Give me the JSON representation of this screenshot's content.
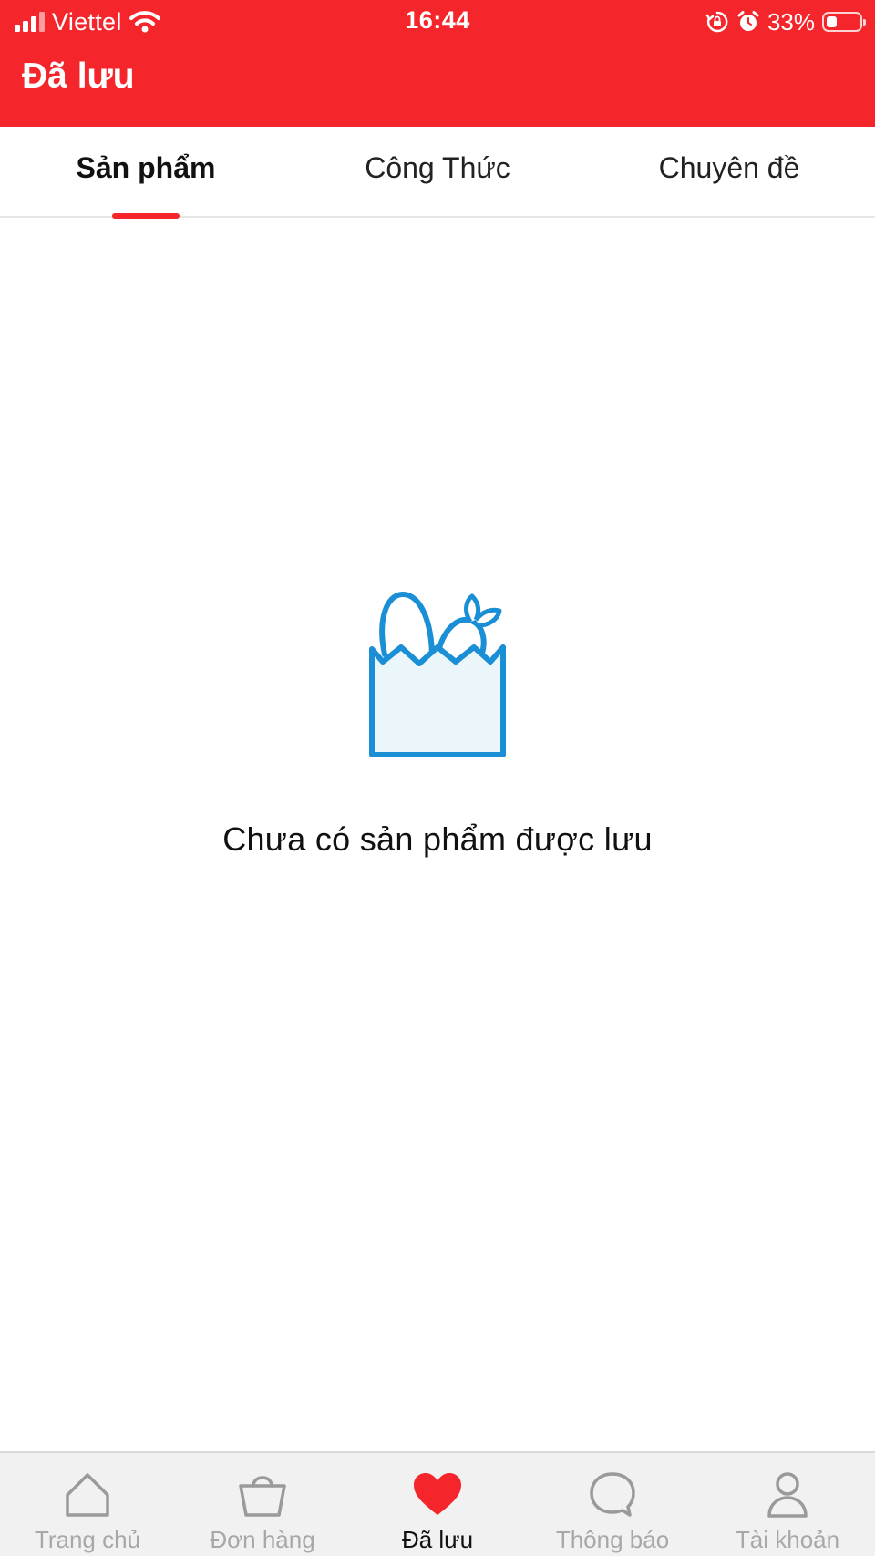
{
  "status_bar": {
    "carrier": "Viettel",
    "time": "16:44",
    "battery_percent": "33%",
    "battery_level": 0.33,
    "icons": [
      "signal-icon",
      "wifi-icon",
      "orientation-lock-icon",
      "alarm-icon",
      "battery-icon"
    ]
  },
  "header": {
    "title": "Đã lưu",
    "background_color": "#f4262b"
  },
  "tabs": [
    {
      "label": "Sản phẩm",
      "active": true
    },
    {
      "label": "Công Thức",
      "active": false
    },
    {
      "label": "Chuyên đề",
      "active": false
    }
  ],
  "empty_state": {
    "icon": "grocery-bag-icon",
    "icon_color": "#1a8fd6",
    "message": "Chưa có sản phẩm được lưu"
  },
  "bottom_nav": [
    {
      "label": "Trang chủ",
      "icon": "home-icon",
      "active": false
    },
    {
      "label": "Đơn hàng",
      "icon": "shopping-bag-icon",
      "active": false
    },
    {
      "label": "Đã lưu",
      "icon": "heart-icon",
      "active": true
    },
    {
      "label": "Thông báo",
      "icon": "chat-bubble-icon",
      "active": false
    },
    {
      "label": "Tài khoản",
      "icon": "user-icon",
      "active": false
    }
  ],
  "colors": {
    "accent": "#f4262b",
    "inactive_nav": "#a8a8a8",
    "nav_background": "#f1f1f1"
  }
}
